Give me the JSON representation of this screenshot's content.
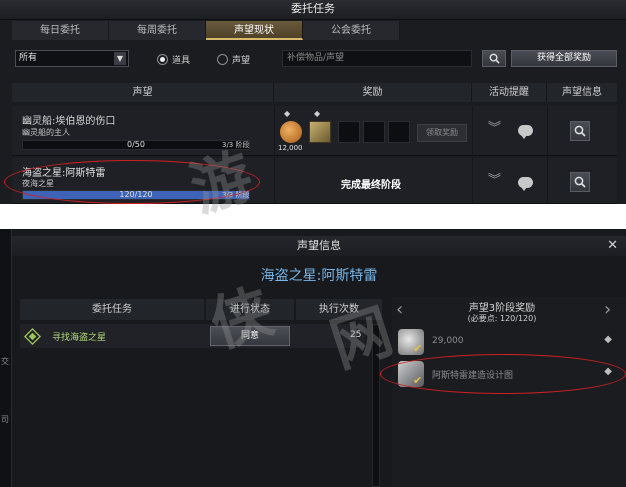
{
  "top_panel": {
    "title": "委托任务",
    "tabs": [
      {
        "label": "每日委托",
        "active": false
      },
      {
        "label": "每周委托",
        "active": false
      },
      {
        "label": "声望现状",
        "active": true
      },
      {
        "label": "公会委托",
        "active": false
      }
    ],
    "filter": {
      "select_value": "所有",
      "radio_items": "道具",
      "radio_reputation": "声望",
      "search_placeholder": "补偿物品/声望",
      "claim_all_label": "获得全部奖励"
    },
    "columns": {
      "reputation": "声望",
      "reward": "奖励",
      "activity_reminder": "活动提醒",
      "reputation_info": "声望信息"
    },
    "rows": [
      {
        "name": "幽灵船:埃伯恩的伤口",
        "subtitle": "幽灵船的主人",
        "progress_text": "0/50",
        "progress": 0.0,
        "stage": "3/3 阶段",
        "reward_count": "12,000",
        "claim_label": "领取奖励"
      },
      {
        "name": "海盗之星:阿斯特雷",
        "subtitle": "夜海之星",
        "progress_text": "120/120",
        "progress": 1.0,
        "stage": "3/3 阶段",
        "final_stage_label": "完成最终阶段"
      }
    ]
  },
  "bottom_panel": {
    "title": "声望信息",
    "subtitle": "海盗之星:阿斯特雷",
    "columns": {
      "quest": "委托任务",
      "status": "进行状态",
      "count": "执行次数"
    },
    "quest_row": {
      "name": "寻找海盗之星",
      "agree_label": "同意",
      "count": "25"
    },
    "stage_reward": {
      "title": "声望3阶段奖励",
      "requirement": "(必要点: 120/120)",
      "items": [
        {
          "label": "29,000",
          "icon": "silver-coin-icon"
        },
        {
          "label": "阿斯特雷建造设计图",
          "icon": "blueprint-icon"
        }
      ]
    },
    "left_strip_text": [
      "交",
      "司"
    ]
  },
  "colors": {
    "accent_gold": "#d8b86a",
    "progress_blue": "#3f63b6",
    "subtitle_blue": "#79b6e8",
    "quest_green": "#b6de77",
    "annotation_red": "#d02020"
  }
}
